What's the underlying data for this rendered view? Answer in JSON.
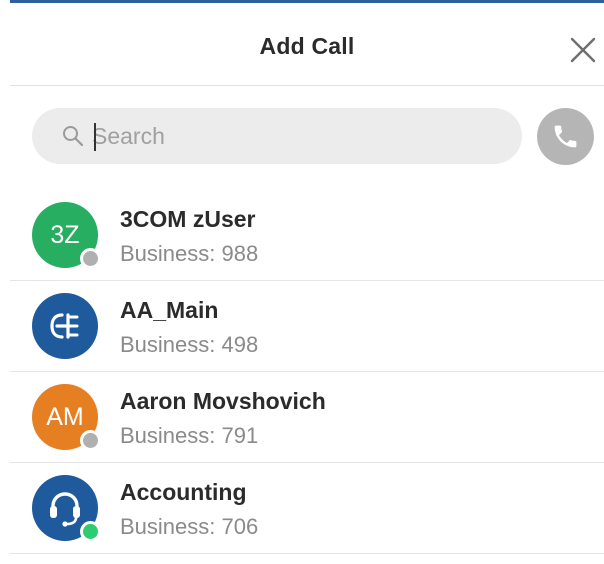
{
  "header": {
    "title": "Add Call",
    "close_icon": "close-icon"
  },
  "search": {
    "placeholder": "Search",
    "value": "",
    "icon": "search-icon"
  },
  "call_button": {
    "icon": "phone-icon",
    "color": "#b5b5b5"
  },
  "contacts": [
    {
      "name": "3COM zUser",
      "subtitle": "Business: 988",
      "initials": "3Z",
      "avatar_color": "#27ae60",
      "presence": "offline",
      "presence_color": "#b0b0b0"
    },
    {
      "name": "AA_Main",
      "subtitle": "Business: 498",
      "initials": "",
      "avatar_icon": "auto-attendant-icon",
      "avatar_color": "#1e5a9c",
      "presence": "none"
    },
    {
      "name": "Aaron Movshovich",
      "subtitle": "Business: 791",
      "initials": "AM",
      "avatar_color": "#e67e22",
      "presence": "offline",
      "presence_color": "#b0b0b0"
    },
    {
      "name": "Accounting",
      "subtitle": "Business: 706",
      "initials": "",
      "avatar_icon": "headset-icon",
      "avatar_color": "#1e5a9c",
      "presence": "online",
      "presence_color": "#2ecc71"
    }
  ],
  "colors": {
    "accent_border": "#2f5f9e",
    "search_bg": "#ececec"
  }
}
